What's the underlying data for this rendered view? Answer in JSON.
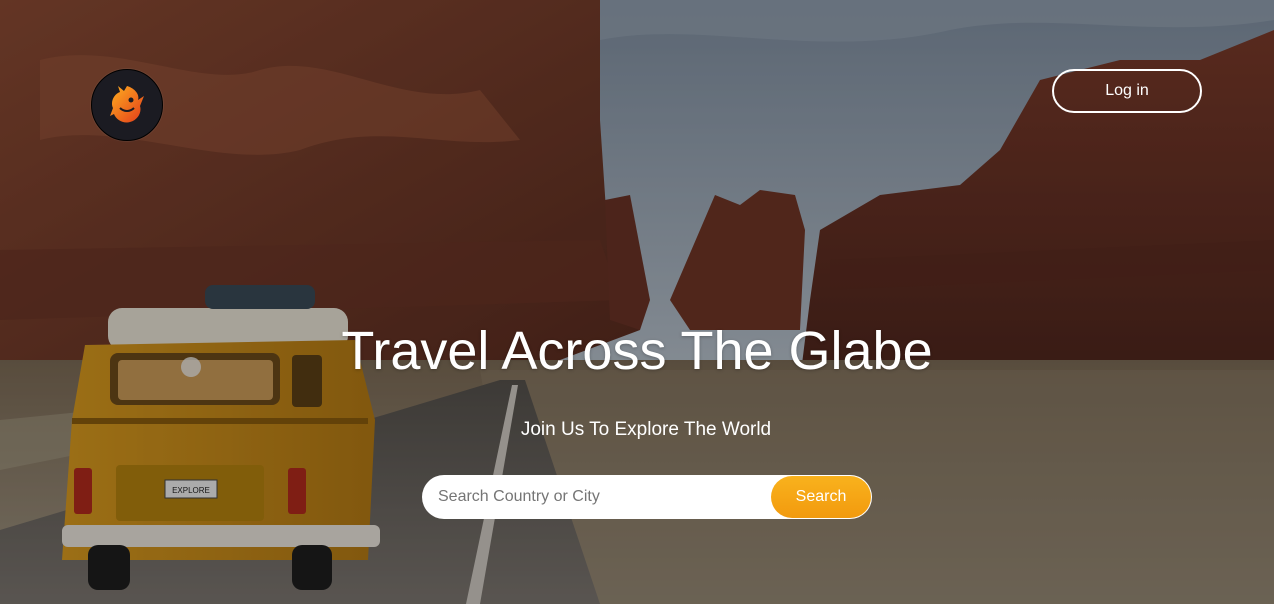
{
  "header": {
    "logo_icon": "dragon-logo-icon",
    "login_label": "Log in"
  },
  "hero": {
    "title": "Travel Across The Glabe",
    "subtitle": "Join Us To Explore The World",
    "background": "desert-canyon-road-with-yellow-van"
  },
  "van": {
    "plate_text": "EXPLORE"
  },
  "search": {
    "placeholder": "Search Country or City",
    "value": "",
    "button_label": "Search"
  },
  "colors": {
    "accent": "#f7a716",
    "text": "#ffffff"
  }
}
